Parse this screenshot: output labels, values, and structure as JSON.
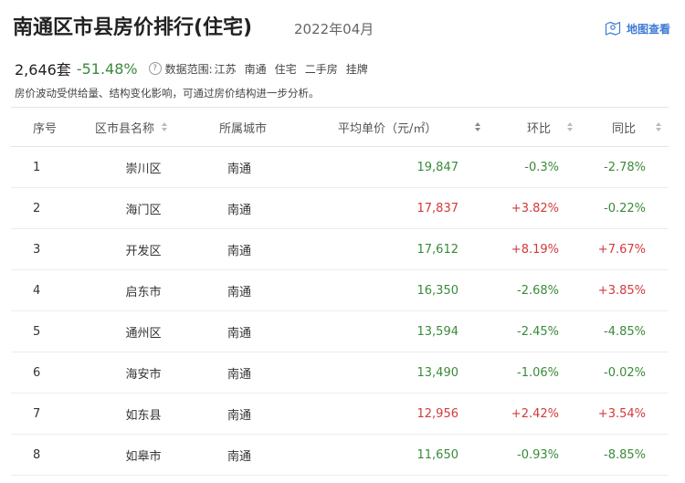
{
  "header": {
    "title": "南通区市县房价排行(住宅)",
    "period": "2022年04月",
    "map_link": "地图查看"
  },
  "stats": {
    "count": "2,646套",
    "change": "-51.48%",
    "help_icon": "question-icon",
    "scope_label": "数据范围:",
    "scope_items": [
      "江苏",
      "南通",
      "住宅",
      "二手房",
      "挂牌"
    ]
  },
  "note": "房价波动受供给量、结构变化影响，可通过房价结构进一步分析。",
  "table": {
    "headers": {
      "index": "序号",
      "name": "区市县名称",
      "city": "所属城市",
      "price": "平均单价（元/㎡）",
      "mom": "环比",
      "yoy": "同比"
    },
    "rows": [
      {
        "index": "1",
        "name": "崇川区",
        "city": "南通",
        "price": "19,847",
        "mom": "-0.3%",
        "yoy": "-2.78%"
      },
      {
        "index": "2",
        "name": "海门区",
        "city": "南通",
        "price": "17,837",
        "mom": "+3.82%",
        "yoy": "-0.22%"
      },
      {
        "index": "3",
        "name": "开发区",
        "city": "南通",
        "price": "17,612",
        "mom": "+8.19%",
        "yoy": "+7.67%"
      },
      {
        "index": "4",
        "name": "启东市",
        "city": "南通",
        "price": "16,350",
        "mom": "-2.68%",
        "yoy": "+3.85%"
      },
      {
        "index": "5",
        "name": "通州区",
        "city": "南通",
        "price": "13,594",
        "mom": "-2.45%",
        "yoy": "-4.85%"
      },
      {
        "index": "6",
        "name": "海安市",
        "city": "南通",
        "price": "13,490",
        "mom": "-1.06%",
        "yoy": "-0.02%"
      },
      {
        "index": "7",
        "name": "如东县",
        "city": "南通",
        "price": "12,956",
        "mom": "+2.42%",
        "yoy": "+3.54%"
      },
      {
        "index": "8",
        "name": "如皋市",
        "city": "南通",
        "price": "11,650",
        "mom": "-0.93%",
        "yoy": "-8.85%"
      }
    ]
  },
  "colors": {
    "up": "#d23a3a",
    "down": "#3a8a3a",
    "link": "#3d7bd6"
  }
}
